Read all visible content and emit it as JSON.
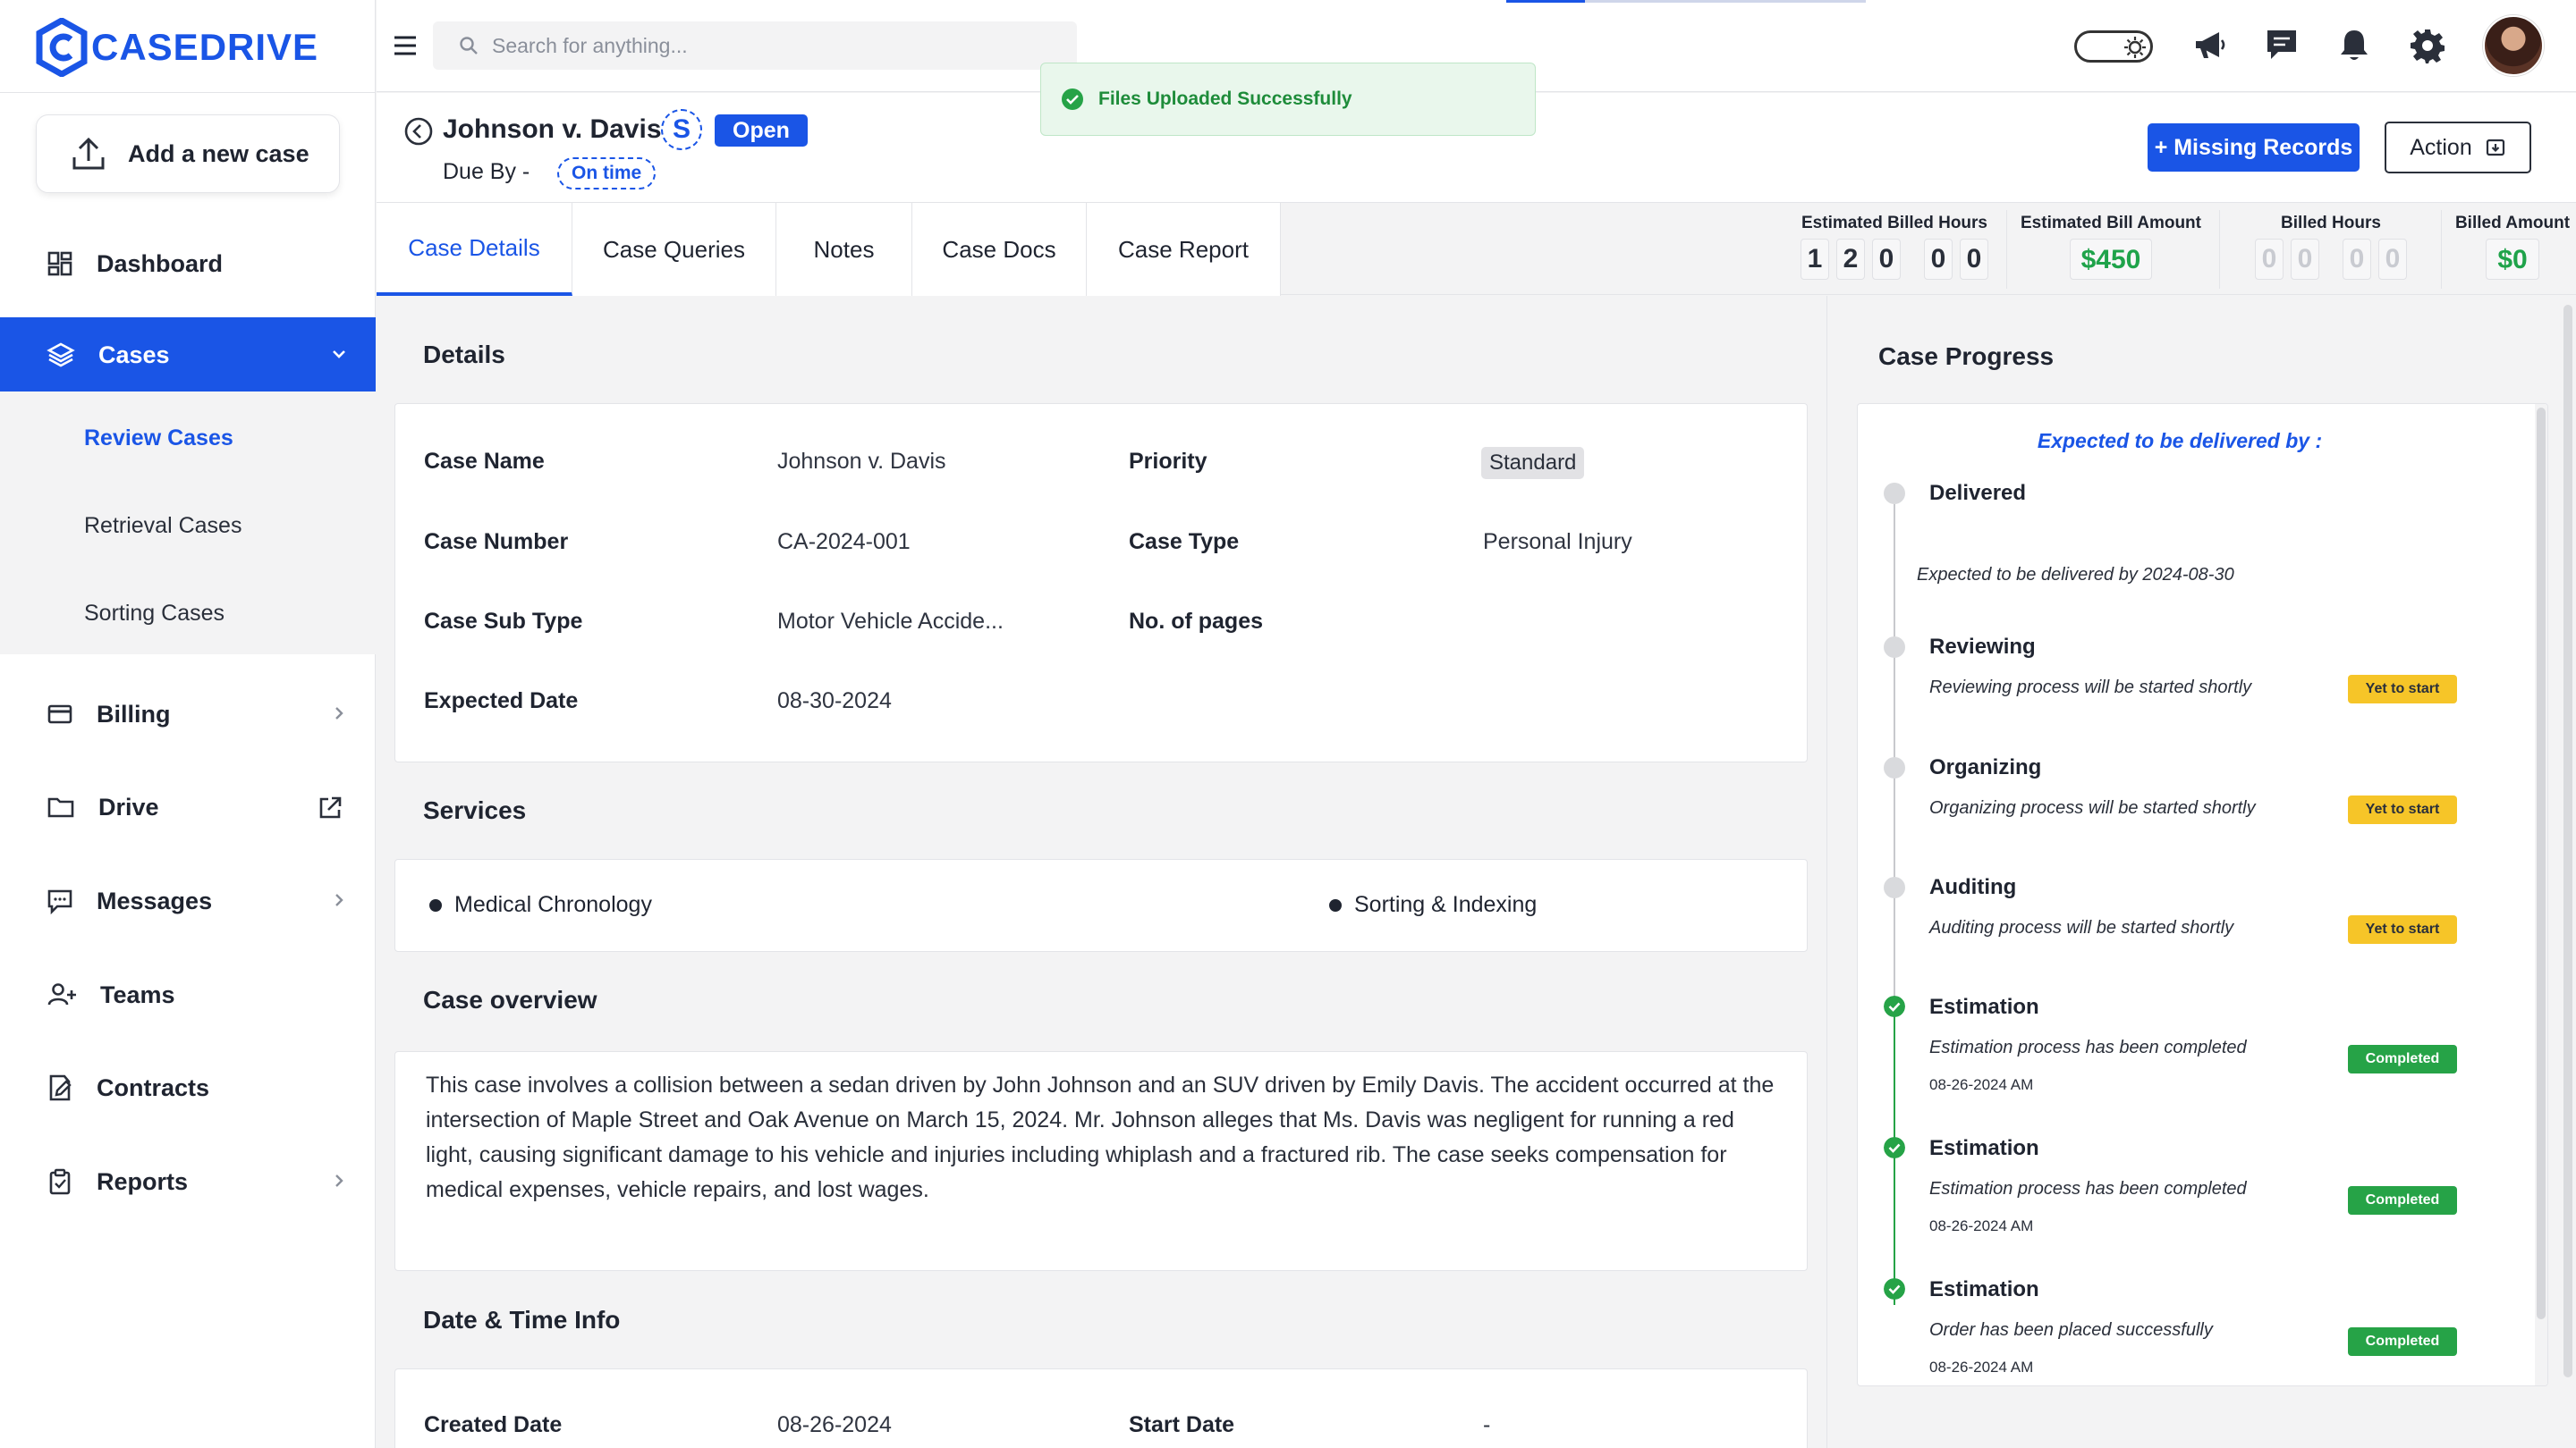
{
  "brand": {
    "name": "CASEDRIVE",
    "accent": "#1a55e6"
  },
  "sidebar": {
    "add_case_label": "Add a new case",
    "items": [
      {
        "label": "Dashboard",
        "icon": "dashboard-grid-icon"
      },
      {
        "label": "Cases",
        "icon": "layers-icon",
        "active": true
      },
      {
        "label": "Billing",
        "icon": "credit-card-icon"
      },
      {
        "label": "Drive",
        "icon": "folder-icon"
      },
      {
        "label": "Messages",
        "icon": "message-square-icon"
      },
      {
        "label": "Teams",
        "icon": "user-plus-icon"
      },
      {
        "label": "Contracts",
        "icon": "file-edit-icon"
      },
      {
        "label": "Reports",
        "icon": "clipboard-icon"
      }
    ],
    "cases_sub": [
      {
        "label": "Review Cases",
        "active": true
      },
      {
        "label": "Retrieval Cases"
      },
      {
        "label": "Sorting Cases"
      }
    ]
  },
  "topbar": {
    "search_placeholder": "Search for anything...",
    "icons": [
      "theme-toggle-icon",
      "megaphone-icon",
      "chat-icon",
      "bell-icon",
      "gear-icon",
      "avatar"
    ]
  },
  "toast": {
    "message": "Files Uploaded Successfully",
    "color": "#1e8c3a"
  },
  "case": {
    "title": "Johnson v. Davis",
    "service_badge": "S",
    "status": "Open",
    "due_label": "Due By -",
    "due_status": "On time",
    "missing_records_label": "+ Missing Records",
    "action_label": "Action"
  },
  "tabs": [
    "Case Details",
    "Case Queries",
    "Notes",
    "Case Docs",
    "Case Report"
  ],
  "metrics": {
    "est_billed_hours": {
      "label": "Estimated Billed Hours",
      "digits": [
        "1",
        "2",
        "0",
        "0",
        "0"
      ]
    },
    "est_bill_amount": {
      "label": "Estimated Bill Amount",
      "value": "$450"
    },
    "billed_hours": {
      "label": "Billed Hours",
      "digits": [
        "0",
        "0",
        "0",
        "0"
      ]
    },
    "billed_amount": {
      "label": "Billed Amount",
      "value": "$0"
    }
  },
  "details": {
    "title": "Details",
    "case_name_label": "Case Name",
    "case_name": "Johnson  v. Davis",
    "priority_label": "Priority",
    "priority": "Standard",
    "case_number_label": "Case Number",
    "case_number": "CA-2024-001",
    "case_type_label": "Case Type",
    "case_type": "Personal Injury",
    "case_sub_type_label": "Case Sub Type",
    "case_sub_type": "Motor Vehicle Accide...",
    "pages_label": "No. of pages",
    "pages": "",
    "expected_date_label": "Expected Date",
    "expected_date": "08-30-2024"
  },
  "services": {
    "title": "Services",
    "items": [
      "Medical Chronology",
      "Sorting & Indexing"
    ]
  },
  "overview": {
    "title": "Case overview",
    "text": "This case involves a collision between a sedan driven by John Johnson and an SUV driven by Emily Davis. The accident occurred at the intersection of Maple Street and Oak Avenue on March 15, 2024. Mr. Johnson alleges that Ms. Davis was negligent for running a red light, causing significant damage to his vehicle and injuries including whiplash and a fractured rib. The case seeks compensation for medical expenses, vehicle repairs, and lost wages."
  },
  "datetime": {
    "title": "Date & Time Info",
    "created_label": "Created Date",
    "created": "08-26-2024",
    "start_label": "Start Date",
    "start": "-"
  },
  "progress": {
    "title": "Case Progress",
    "expected_heading": "Expected to be delivered by :",
    "steps": [
      {
        "name": "Delivered",
        "desc": "Expected to be delivered by 2024-08-30",
        "status": "",
        "time": ""
      },
      {
        "name": "Reviewing",
        "desc": "Reviewing process will be started shortly",
        "status": "Yet to start",
        "time": ""
      },
      {
        "name": "Organizing",
        "desc": "Organizing process will be started shortly",
        "status": "Yet to start",
        "time": ""
      },
      {
        "name": "Auditing",
        "desc": "Auditing process will be started shortly",
        "status": "Yet to start",
        "time": ""
      },
      {
        "name": "Estimation",
        "desc": "Estimation process has been completed",
        "status": "Completed",
        "time": "08-26-2024 AM"
      },
      {
        "name": "Estimation",
        "desc": "Estimation process has been completed",
        "status": "Completed",
        "time": "08-26-2024 AM"
      },
      {
        "name": "Estimation",
        "desc": "Order has been placed successfully",
        "status": "Completed",
        "time": "08-26-2024 AM"
      }
    ]
  }
}
